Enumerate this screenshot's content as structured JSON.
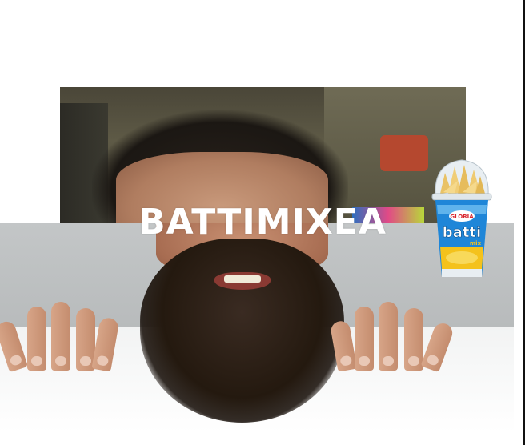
{
  "headline": "BATTIMIXEA",
  "product": {
    "brand_label": "GLORIA",
    "name_label": "batti",
    "sub_label": "mix",
    "colors": {
      "cup_blue": "#1f86d8",
      "cup_yellow": "#f4c21c",
      "lid": "#e8eef2",
      "snack": "#e9c266",
      "brand_red": "#d8262e"
    }
  },
  "palette": {
    "background": "#ffffff",
    "headline_color": "#ffffff",
    "top_photo": "#4a4638",
    "bottom_photo": "#c3c6c7"
  }
}
